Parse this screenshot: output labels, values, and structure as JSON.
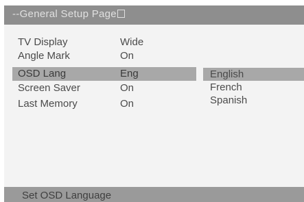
{
  "header": {
    "title": "--General Setup Page",
    "title_end_icon": "square-outline-icon"
  },
  "menu": {
    "rows": [
      {
        "label": "TV Display",
        "value": "Wide",
        "selected": false
      },
      {
        "label": "Angle Mark",
        "value": "On",
        "selected": false
      },
      {
        "label": "OSD Lang",
        "value": "Eng",
        "selected": true
      },
      {
        "label": "Screen Saver",
        "value": "On",
        "selected": false
      },
      {
        "label": "Last Memory",
        "value": "On",
        "selected": false
      }
    ]
  },
  "submenu": {
    "options": [
      {
        "label": "English",
        "selected": true
      },
      {
        "label": "French",
        "selected": false
      },
      {
        "label": "Spanish",
        "selected": false
      }
    ]
  },
  "status": {
    "text": "Set OSD Language"
  },
  "colors": {
    "screen_bg": "#f3f3f3",
    "bar_bg": "#8e8e8e",
    "highlight": "#a8a8a8",
    "text": "#4a4a4a"
  }
}
